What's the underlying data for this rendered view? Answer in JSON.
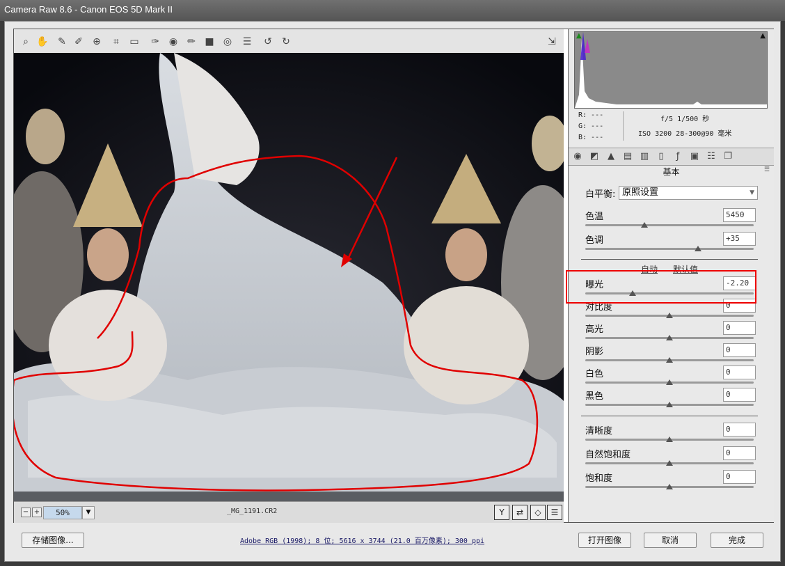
{
  "window": {
    "title": "Camera Raw 8.6 -  Canon EOS 5D Mark II"
  },
  "toolbar": {
    "tools": [
      "zoom-icon",
      "hand-icon",
      "white-balance-icon",
      "color-sampler-icon",
      "targeted-adjust-icon",
      "crop-icon",
      "straighten-icon",
      "spot-removal-icon",
      "red-eye-icon",
      "adjustment-brush-icon",
      "graduated-filter-icon",
      "radial-filter-icon",
      "preferences-icon",
      "rotate-left-icon",
      "rotate-right-icon"
    ],
    "fullscreen_icon": "fullscreen-icon"
  },
  "statusbar": {
    "zoom_out": "−",
    "zoom_in": "+",
    "zoom_value": "50%",
    "filename": "_MG_1191.CR2",
    "view_buttons": [
      "Y",
      "⇄",
      "◇",
      "☰"
    ]
  },
  "info": {
    "r": "R:  ---",
    "g": "G:  ---",
    "b": "B:  ---",
    "aperture_shutter": "f/5   1/500 秒",
    "iso_lens": "ISO 3200   28-300@90 毫米"
  },
  "panel": {
    "title": "基本",
    "white_balance_label": "白平衡:",
    "white_balance_value": "原照设置",
    "auto_label": "自动",
    "default_label": "默认值",
    "sliders": [
      {
        "label": "色温",
        "value": "5450",
        "pos": 0.35
      },
      {
        "label": "色调",
        "value": "+35",
        "pos": 0.67
      },
      {
        "label": "曝光",
        "value": "-2.20",
        "pos": 0.28
      },
      {
        "label": "对比度",
        "value": "0",
        "pos": 0.5
      },
      {
        "label": "高光",
        "value": "0",
        "pos": 0.5
      },
      {
        "label": "阴影",
        "value": "0",
        "pos": 0.5
      },
      {
        "label": "白色",
        "value": "0",
        "pos": 0.5
      },
      {
        "label": "黑色",
        "value": "0",
        "pos": 0.5
      },
      {
        "label": "清晰度",
        "value": "0",
        "pos": 0.5
      },
      {
        "label": "自然饱和度",
        "value": "0",
        "pos": 0.5
      },
      {
        "label": "饱和度",
        "value": "0",
        "pos": 0.5
      }
    ]
  },
  "bottom": {
    "save_label": "存储图像...",
    "workflow": "Adobe RGB (1998); 8 位; 5616 x 3744 (21.0 百万像素); 300 ppi",
    "open_label": "打开图像",
    "cancel_label": "取消",
    "done_label": "完成"
  },
  "colors": {
    "annotation": "#e00000",
    "zoom_field": "#c6d9ec"
  }
}
